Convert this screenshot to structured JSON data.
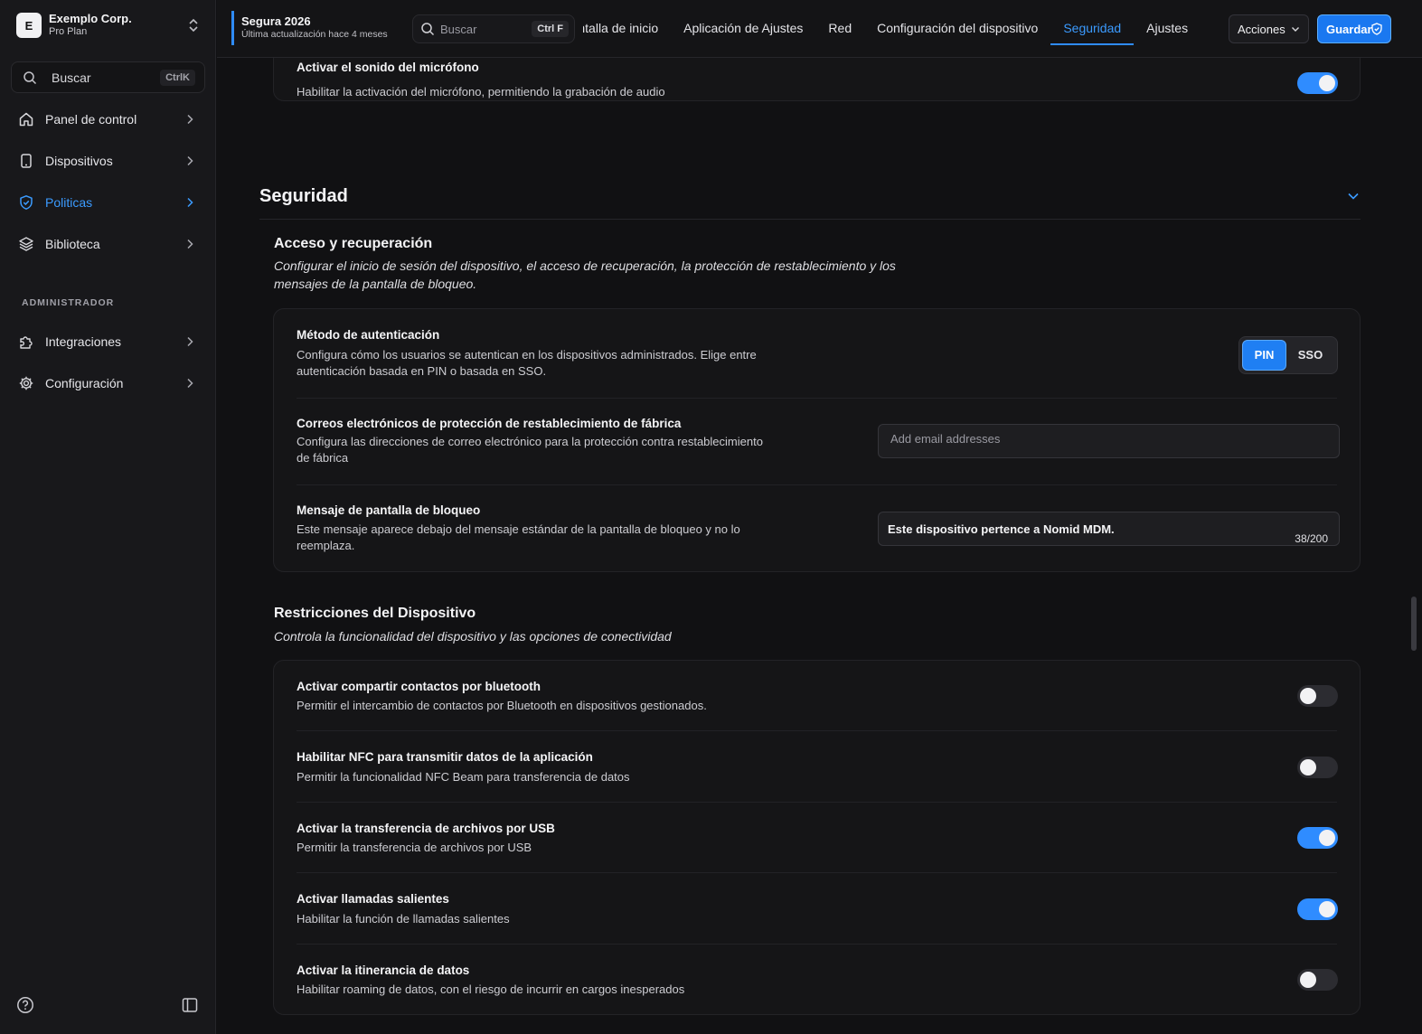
{
  "org": {
    "initial": "E",
    "name": "Exemplo Corp.",
    "plan": "Pro Plan"
  },
  "sidebar": {
    "search_label": "Buscar",
    "search_shortcut": "CtrlK",
    "items": [
      {
        "label": "Panel de control",
        "icon": "home-icon"
      },
      {
        "label": "Dispositivos",
        "icon": "device-icon"
      },
      {
        "label": "Politicas",
        "icon": "shield-icon",
        "active": true
      },
      {
        "label": "Biblioteca",
        "icon": "layers-icon"
      }
    ],
    "admin_label": "ADMINISTRADOR",
    "admin_items": [
      {
        "label": "Integraciones",
        "icon": "puzzle-icon"
      },
      {
        "label": "Configuración",
        "icon": "gear-icon"
      }
    ]
  },
  "topbar": {
    "policy_name": "Segura 2026",
    "policy_updated": "Última actualización hace 4 meses",
    "search_placeholder": "Buscar",
    "search_shortcut": "Ctrl F",
    "tabs": [
      "Restricciones y pantalla de inicio",
      "Aplicación de Ajustes",
      "Red",
      "Configuración del dispositivo",
      "Seguridad",
      "Ajustes"
    ],
    "active_tab": "Seguridad",
    "actions_label": "Acciones",
    "save_label": "Guardar"
  },
  "colors": {
    "accent": "#2f8cff",
    "background": "#111113",
    "sidebar": "#18181b"
  },
  "main": {
    "prev_row": {
      "title": "Activar el sonido del micrófono",
      "desc": "Habilitar la activación del micrófono, permitiendo la grabación de audio",
      "on": true
    },
    "section_title": "Seguridad",
    "access": {
      "title": "Acceso y recuperación",
      "desc_line1": "Configurar el inicio de sesión del dispositivo, el acceso de recuperación, la protección de restablecimiento y los",
      "desc_line2": "mensajes de la pantalla de bloqueo.",
      "auth": {
        "title": "Método de autenticación",
        "desc_line1": "Configura cómo los usuarios se autentican en los dispositivos administrados. Elige entre",
        "desc_line2": "autenticación basada en PIN o basada en SSO.",
        "options": [
          "PIN",
          "SSO"
        ],
        "selected": "PIN"
      },
      "frp": {
        "title": "Correos electrónicos de protección de restablecimiento de fábrica",
        "desc_line1": "Configura las direcciones de correo electrónico para la protección contra restablecimiento",
        "desc_line2": "de fábrica",
        "placeholder": "Add email addresses"
      },
      "lock": {
        "title": "Mensaje de pantalla de bloqueo",
        "desc_line1": "Este mensaje aparece debajo del mensaje estándar de la pantalla de bloqueo y no lo",
        "desc_line2": "reemplaza.",
        "value": "Este dispositivo pertence a Nomid MDM.",
        "counter": "38/200"
      }
    },
    "restrictions": {
      "title": "Restricciones del Dispositivo",
      "desc": "Controla la funcionalidad del dispositivo y las opciones de conectividad",
      "rows": [
        {
          "title": "Activar compartir contactos por bluetooth",
          "desc": "Permitir el intercambio de contactos por Bluetooth en dispositivos gestionados.",
          "on": false
        },
        {
          "title": "Habilitar NFC para transmitir datos de la aplicación",
          "desc": "Permitir la funcionalidad NFC Beam para transferencia de datos",
          "on": false
        },
        {
          "title": "Activar la transferencia de archivos por USB",
          "desc": "Permitir la transferencia de archivos por USB",
          "on": true
        },
        {
          "title": "Activar llamadas salientes",
          "desc": "Habilitar la función de llamadas salientes",
          "on": true
        },
        {
          "title": "Activar la itinerancia de datos",
          "desc": "Habilitar roaming de datos, con el riesgo de incurrir en cargos inesperados",
          "on": false
        }
      ]
    }
  }
}
